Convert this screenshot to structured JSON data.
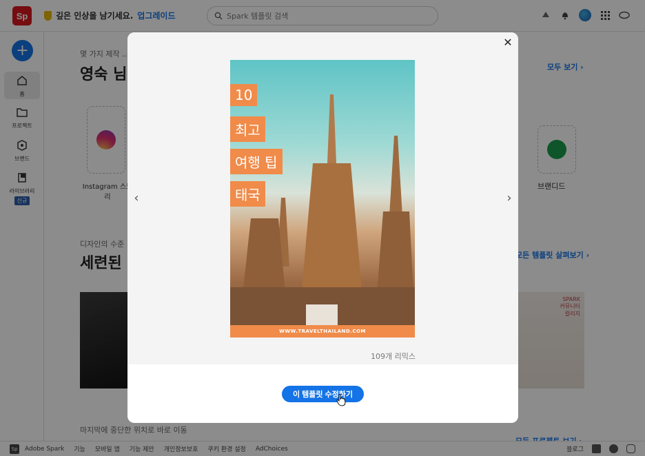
{
  "app": {
    "logo_text": "Sp",
    "promo_text": "깊은 인상을 남기세요.",
    "promo_link": "업그레이드",
    "search_placeholder": "Spark 템플릿 검색"
  },
  "sidebar": {
    "create_symbol": "+",
    "items": [
      {
        "label": "홈",
        "icon": "home-icon"
      },
      {
        "label": "프로젝트",
        "icon": "folder-icon"
      },
      {
        "label": "브랜드",
        "icon": "brand-icon"
      },
      {
        "label": "라이브러리",
        "icon": "library-icon",
        "badge": "신규"
      }
    ]
  },
  "main": {
    "section1_sub": "몇 가지 제작 ...",
    "section1_title": "영숙 님",
    "section1_link": "모두 보기 ›",
    "tile1_label": "Instagram 스토리",
    "tile2_label": "브랜디드",
    "section2_sub": "디자인의 수준",
    "section2_title": "세련된",
    "section2_link": "모든 템플릿 살펴보기 ›",
    "card_right_text": "SPARK\n커뮤니티\n칼리지",
    "section3_sub": "마지막에 중단한 위치로 바로 이동",
    "section3_link": "모든 프로젝트 보기 ›"
  },
  "modal": {
    "close_symbol": "✕",
    "prev_symbol": "‹",
    "next_symbol": "›",
    "poster": {
      "lines": [
        "10",
        "최고",
        "여행 팁",
        "태국"
      ],
      "url": "WWW.TRAVELTHAILAND.COM"
    },
    "remix_count": "109개 리믹스",
    "edit_button": "이 템플릿 수정하기"
  },
  "footer": {
    "brand": "Adobe Spark",
    "links": [
      "기능",
      "모바일 앱",
      "기능 제안",
      "개인정보보호",
      "쿠키 환경 설정",
      "AdChoices"
    ],
    "blog": "블로그",
    "social_icons": [
      "facebook-icon",
      "twitter-icon",
      "instagram-icon"
    ]
  },
  "colors": {
    "accent": "#1473e6",
    "poster_orange": "#f08b4a",
    "logo_red": "#d7191f"
  }
}
